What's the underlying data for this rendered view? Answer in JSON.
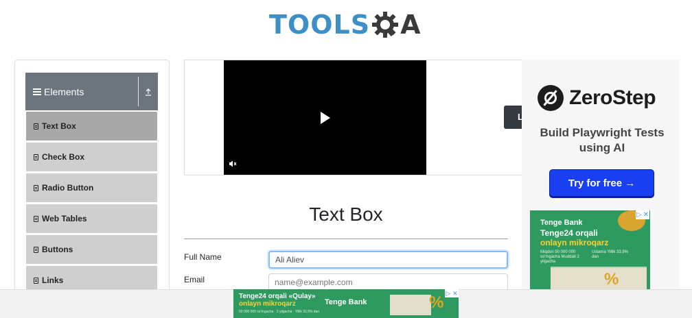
{
  "header": {
    "logo_tools": "TOOLS",
    "logo_a": "A"
  },
  "sidebar": {
    "group_title": "Elements",
    "items": [
      {
        "label": "Text Box",
        "active": true
      },
      {
        "label": "Check Box",
        "active": false
      },
      {
        "label": "Radio Button",
        "active": false
      },
      {
        "label": "Web Tables",
        "active": false
      },
      {
        "label": "Buttons",
        "active": false
      },
      {
        "label": "Links",
        "active": false
      }
    ]
  },
  "video": {
    "side_button_label": "L"
  },
  "main": {
    "title": "Text Box",
    "full_name_label": "Full Name",
    "full_name_value": "Ali Aliev",
    "email_label": "Email",
    "email_placeholder": "name@example.com"
  },
  "ad_right": {
    "brand": "ZeroStep",
    "tagline": "Build Playwright Tests using AI",
    "cta": "Try for free →"
  },
  "ad_tenge": {
    "brand": "Tenge Bank",
    "headline_line1": "Tenge24 orqali",
    "headline_line2": "onlayn mikroqarz",
    "detail_left": "Miqdori 50 000 000 so'mgacha Muddati 2 yilgacha",
    "detail_right": "Ustama Yillik 33,9% dan",
    "percent": "%"
  },
  "ad_bottom": {
    "headline_line1": "Tenge24 orqali «Qulay»",
    "headline_line2": "onlayn mikroqarz",
    "detail": "50 000 000 so'mgacha · 2 yilgacha · Yillik 33,9% dan",
    "brand": "Tenge Bank",
    "percent": "%"
  },
  "colors": {
    "accent": "#3f8fc7",
    "sidebar_header": "#6c757d",
    "menu_item": "#cfcfcf",
    "menu_item_active": "#a8a8a8",
    "cta_blue": "#1a3ff0",
    "ad_green": "#2f9a5f"
  }
}
